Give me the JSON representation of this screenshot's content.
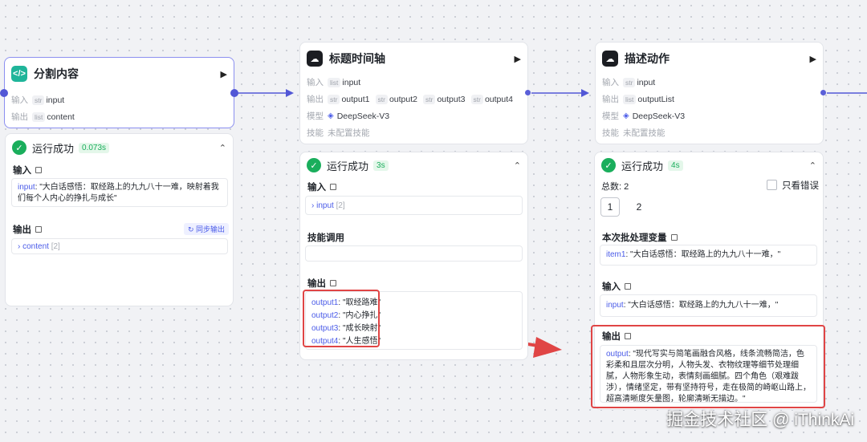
{
  "nodes": {
    "split": {
      "title": "分割内容",
      "icon": "code-icon",
      "input_label": "输入",
      "input": {
        "type": "str",
        "name": "input"
      },
      "output_label": "输出",
      "output": {
        "type": "list",
        "name": "content"
      }
    },
    "timeline": {
      "title": "标题时间轴",
      "icon": "model-avatar-icon",
      "input_label": "输入",
      "input": {
        "type": "list",
        "name": "input"
      },
      "output_label": "输出",
      "outputs": [
        {
          "type": "str",
          "name": "output1"
        },
        {
          "type": "str",
          "name": "output2"
        },
        {
          "type": "str",
          "name": "output3"
        },
        {
          "type": "str",
          "name": "output4"
        }
      ],
      "model_label": "模型",
      "model": "DeepSeek-V3",
      "skill_label": "技能",
      "skill": "未配置技能"
    },
    "action": {
      "title": "描述动作",
      "icon": "model-avatar-icon",
      "input_label": "输入",
      "input": {
        "type": "str",
        "name": "input"
      },
      "output_label": "输出",
      "output": {
        "type": "list",
        "name": "outputList"
      },
      "model_label": "模型",
      "model": "DeepSeek-V3",
      "skill_label": "技能",
      "skill": "未配置技能"
    }
  },
  "panels": {
    "split": {
      "status": "运行成功",
      "duration": "0.073s",
      "input_title": "输入",
      "input_key": "input",
      "input_value": "\"大白话感悟：取经路上的九九八十一难，映射着我们每个人内心的挣扎与成长\"",
      "output_title": "输出",
      "sync_label": "同步输出",
      "output_key": "content",
      "output_count": "[2]"
    },
    "timeline": {
      "status": "运行成功",
      "duration": "3s",
      "input_title": "输入",
      "input_key": "input",
      "input_count": "[2]",
      "skill_title": "技能调用",
      "output_title": "输出",
      "outputs": [
        {
          "key": "output1",
          "value": "\"取经路难\""
        },
        {
          "key": "output2",
          "value": "\"内心挣扎\""
        },
        {
          "key": "output3",
          "value": "\"成长映射\""
        },
        {
          "key": "output4",
          "value": "\"人生感悟\""
        }
      ]
    },
    "action": {
      "status": "运行成功",
      "duration": "4s",
      "total": "总数: 2",
      "errors_only": "只看错误",
      "pages": [
        "1",
        "2"
      ],
      "batch_title": "本次批处理变量",
      "batch_key": "item1",
      "batch_value": "\"大白话感悟：取经路上的九九八十一难，\"",
      "input_title": "输入",
      "input_key": "input",
      "input_value": "\"大白话感悟：取经路上的九九八十一难，\"",
      "output_title": "输出",
      "output_key": "output",
      "output_value": "\"现代写实与简笔画融合风格，线条流畅简洁，色彩柔和且层次分明，人物头发、衣物纹理等细节处理细腻，人物形象生动，表情刻画细腻。四个角色（艰难跋涉），情绪坚定，带有坚持符号，走在极简的崎岖山路上，超高清晰度矢量图，轮廓清晰无描边。\""
    }
  },
  "watermark": "掘金技术社区 @ iThinkAi",
  "colors": {
    "accent": "#5257d6",
    "success": "#1aae5c",
    "highlight": "#e04545"
  }
}
